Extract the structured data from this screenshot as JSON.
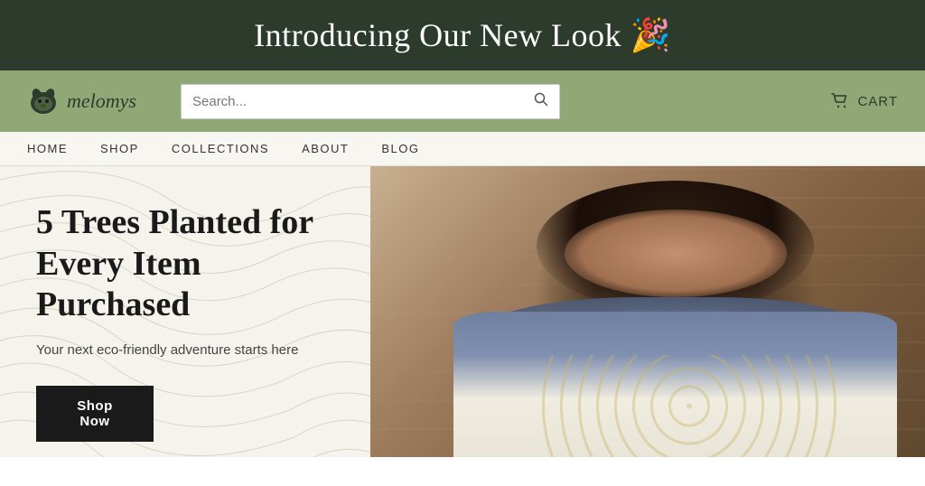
{
  "announcement": {
    "text": "Introducing Our New Look 🎉"
  },
  "header": {
    "logo_text": "melomys",
    "search_placeholder": "Search...",
    "cart_label": "CART"
  },
  "nav": {
    "items": [
      {
        "label": "HOME"
      },
      {
        "label": "SHOP"
      },
      {
        "label": "COLLECTIONS"
      },
      {
        "label": "ABOUT"
      },
      {
        "label": "BLOG"
      }
    ]
  },
  "hero": {
    "heading": "5 Trees Planted for Every Item Purchased",
    "subtext": "Your next eco-friendly adventure starts here",
    "cta_label": "Shop Now"
  },
  "colors": {
    "announcement_bg": "#2d3b2d",
    "header_bg": "#8fa876",
    "nav_bg": "#f8f6f0",
    "hero_left_bg": "#f5f3ec",
    "cta_bg": "#1a1a1a"
  }
}
